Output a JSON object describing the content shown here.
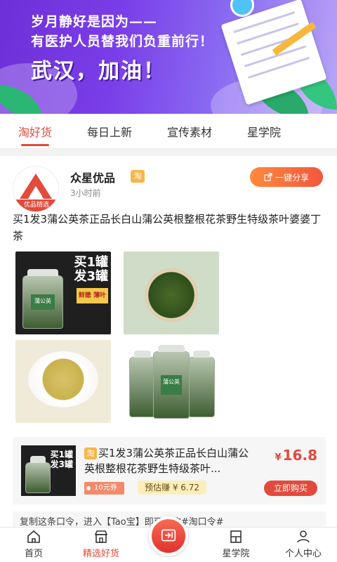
{
  "banner": {
    "line1": "岁月静好是因为——",
    "line2": "有医护人员替我们负重前行！",
    "headline": "武汉，加油！"
  },
  "tabs": [
    {
      "label": "淘好货",
      "active": true
    },
    {
      "label": "每日上新",
      "active": false
    },
    {
      "label": "宣传素材",
      "active": false
    },
    {
      "label": "星学院",
      "active": false
    }
  ],
  "post": {
    "shop_name": "众星优品",
    "avatar_ribbon": "优品精选",
    "platform_badge": "淘",
    "time": "3小时前",
    "share_label": "一键分享",
    "description": "买1发3蒲公英茶正品长白山蒲公英根整根花茶野生特级茶叶婆婆丁茶",
    "image_promo": {
      "line1": "买1罐",
      "line2": "发3罐",
      "tag": "鲜嫩 薄叶"
    },
    "jar_label": "蒲公英"
  },
  "product": {
    "badge": "淘",
    "title": "买1发3蒲公英茶正品长白山蒲公英根整根花茶野生特级茶叶...",
    "currency": "¥",
    "price": "16.8",
    "coupon": "10元券",
    "earn": "预估赚 ¥ 6.72",
    "buy_label": "立即购买",
    "thumb_promo": {
      "line1": "买1罐",
      "line2": "发3罐"
    }
  },
  "copy_bar": "复制这条口令，进入【Tao宝】即可抢购#淘口令#",
  "bottom_nav": [
    {
      "label": "首页",
      "icon": "home-icon"
    },
    {
      "label": "精选好货",
      "icon": "shop-icon",
      "active": true
    },
    {
      "label": "",
      "icon": "share-center-icon"
    },
    {
      "label": "星学院",
      "icon": "academy-icon"
    },
    {
      "label": "个人中心",
      "icon": "user-icon"
    }
  ],
  "colors": {
    "accent": "#e24a3b",
    "banner": "#7a3ee8",
    "badge": "#f7b64a"
  }
}
